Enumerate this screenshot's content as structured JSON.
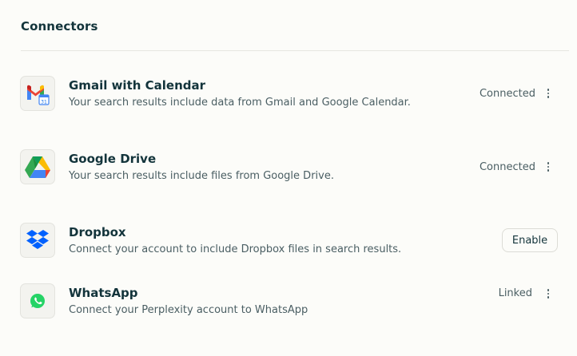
{
  "section": {
    "title": "Connectors"
  },
  "connectors": [
    {
      "name": "Gmail with Calendar",
      "description": "Your search results include data from Gmail and Google Calendar.",
      "status": "Connected",
      "icon": "gmail-calendar-icon"
    },
    {
      "name": "Google Drive",
      "description": "Your search results include files from Google Drive.",
      "status": "Connected",
      "icon": "google-drive-icon"
    },
    {
      "name": "Dropbox",
      "description": "Connect your account to include Dropbox files in search results.",
      "action_label": "Enable",
      "icon": "dropbox-icon"
    },
    {
      "name": "WhatsApp",
      "description": "Connect your Perplexity account to WhatsApp",
      "status": "Linked",
      "icon": "whatsapp-icon"
    }
  ],
  "colors": {
    "background": "#fcfcf9",
    "text_primary": "#13343b",
    "text_secondary": "#4a5e63",
    "whatsapp_green": "#25d366",
    "dropbox_blue": "#0061fe"
  }
}
